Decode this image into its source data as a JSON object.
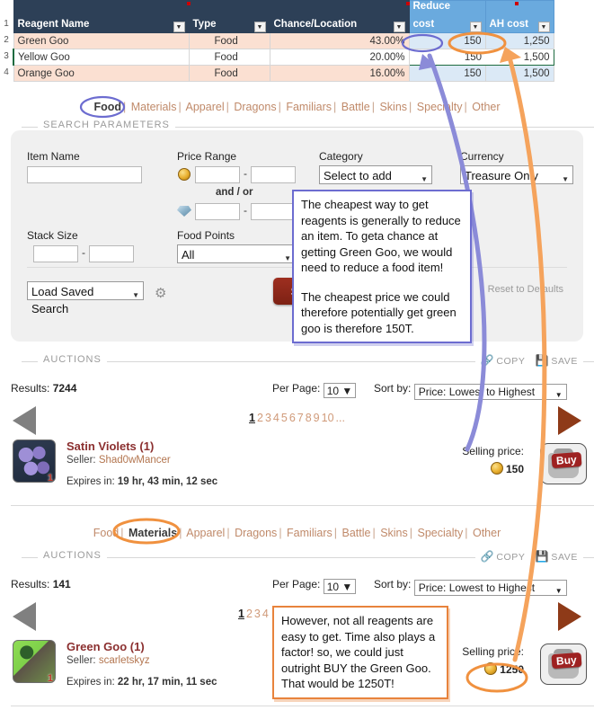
{
  "spreadsheet": {
    "row_numbers": [
      "1",
      "2",
      "3",
      "4"
    ],
    "columns": [
      "Reagent Name",
      "Type",
      "Chance/Location",
      "Reduce cost",
      "AH cost"
    ],
    "rows": [
      {
        "name": "Green Goo",
        "type": "Food",
        "chance": "43.00%",
        "reduce_cost": "150",
        "ah_cost": "1,250"
      },
      {
        "name": "Yellow Goo",
        "type": "Food",
        "chance": "20.00%",
        "reduce_cost": "150",
        "ah_cost": "1,500"
      },
      {
        "name": "Orange Goo",
        "type": "Food",
        "chance": "16.00%",
        "reduce_cost": "150",
        "ah_cost": "1,500"
      }
    ]
  },
  "tabs_top": {
    "items": [
      "Food",
      "Materials",
      "Apparel",
      "Dragons",
      "Familiars",
      "Battle",
      "Skins",
      "Specialty",
      "Other"
    ],
    "selected": "Food"
  },
  "tabs_bottom": {
    "items": [
      "Food",
      "Materials",
      "Apparel",
      "Dragons",
      "Familiars",
      "Battle",
      "Skins",
      "Specialty",
      "Other"
    ],
    "selected": "Materials"
  },
  "search": {
    "legend": "SEARCH PARAMETERS",
    "item_name_label": "Item Name",
    "item_name_value": "",
    "price_range_label": "Price Range",
    "price_min": "",
    "price_max": "",
    "and_or": "and / or",
    "gem_min": "",
    "gem_max": "",
    "stack_size_label": "Stack Size",
    "stack_min": "",
    "stack_max": "",
    "food_points_label": "Food Points",
    "food_points_value": "All",
    "category_label": "Category",
    "category_value": "Select to add",
    "currency_label": "Currency",
    "currency_value": "Treasure Only",
    "load_saved_search": "Load Saved Search",
    "search_button": "Search",
    "reset_label": "Reset to Defaults",
    "gear_icon": "gear-icon"
  },
  "auctions_food": {
    "legend": "AUCTIONS",
    "copy_label": "COPY",
    "save_label": "SAVE",
    "results_label": "Results:",
    "results_count": "7244",
    "per_page_label": "Per Page:",
    "per_page_value": "10",
    "sort_label": "Sort by:",
    "sort_value": "Price: Lowest to Highest",
    "pages": [
      "1",
      "2",
      "3",
      "4",
      "5",
      "6",
      "7",
      "8",
      "9",
      "10",
      "..."
    ],
    "current_page": "1",
    "listing": {
      "title": "Satin Violets (1)",
      "seller_label": "Seller:",
      "seller_name": "Shad0wMancer",
      "quantity": "1",
      "expires_label": "Expires in:",
      "expires_value": "19 hr, 43 min, 12 sec",
      "price_label": "Selling price:",
      "price_value": "150",
      "buy_label": "Buy"
    }
  },
  "auctions_materials": {
    "legend": "AUCTIONS",
    "copy_label": "COPY",
    "save_label": "SAVE",
    "results_label": "Results:",
    "results_count": "141",
    "per_page_label": "Per Page:",
    "per_page_value": "10",
    "sort_label": "Sort by:",
    "sort_value": "Price: Lowest to Highest",
    "pages": [
      "1",
      "2",
      "3",
      "4"
    ],
    "current_page": "1",
    "listing": {
      "title": "Green Goo (1)",
      "seller_label": "Seller:",
      "seller_name": "scarletskyz",
      "quantity": "1",
      "expires_label": "Expires in:",
      "expires_value": "22 hr, 17 min, 11 sec",
      "price_label": "Selling price:",
      "price_value": "1250",
      "buy_label": "Buy"
    }
  },
  "callouts": {
    "blue": {
      "p1": "The cheapest way to get reagents is generally to reduce an item. To geta chance at getting Green Goo, we would need to reduce a food item!",
      "p2": "The cheapest price we could therefore potentially get green goo is therefore 150T."
    },
    "orange": {
      "p1": "However, not all reagents are easy to get. Time also plays a factor! so, we could just outright BUY the Green Goo. That would be 1250T!"
    }
  },
  "colors": {
    "header_dark": "#2d4057",
    "header_blue": "#6aaade",
    "row_highlight": "#fbe0d2",
    "annotation_blue": "#6c6cd0",
    "annotation_orange": "#e8833c",
    "link_orange": "#c08a6a",
    "search_red": "#7d2114"
  }
}
